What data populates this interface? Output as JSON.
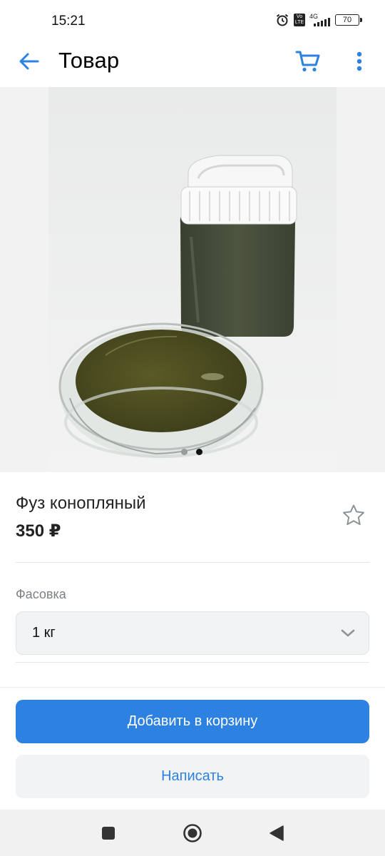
{
  "status_bar": {
    "time": "15:21",
    "network": "4G",
    "volte": "Vo LTE",
    "battery": "70",
    "icons": [
      "alarm-icon",
      "volte-icon",
      "signal-icon",
      "battery-icon"
    ]
  },
  "header": {
    "title": "Товар",
    "back_icon": "arrow-left-icon",
    "cart_icon": "cart-icon",
    "more_icon": "more-vertical-icon"
  },
  "gallery": {
    "dots_total": 2,
    "active_dot": 2
  },
  "product": {
    "name": "Фуз конопляный",
    "price": "350 ₽",
    "favorite_icon": "star-outline-icon"
  },
  "packaging": {
    "label": "Фасовка",
    "selected": "1 кг",
    "chevron_icon": "chevron-down-icon"
  },
  "actions": {
    "add_to_cart": "Добавить в корзину",
    "write": "Написать"
  },
  "nav": {
    "recent": "square-icon",
    "home": "circle-icon",
    "back": "triangle-back-icon"
  },
  "colors": {
    "accent": "#2d81e0",
    "secondary_bg": "#f2f3f5",
    "muted_text": "#7b7f86"
  }
}
